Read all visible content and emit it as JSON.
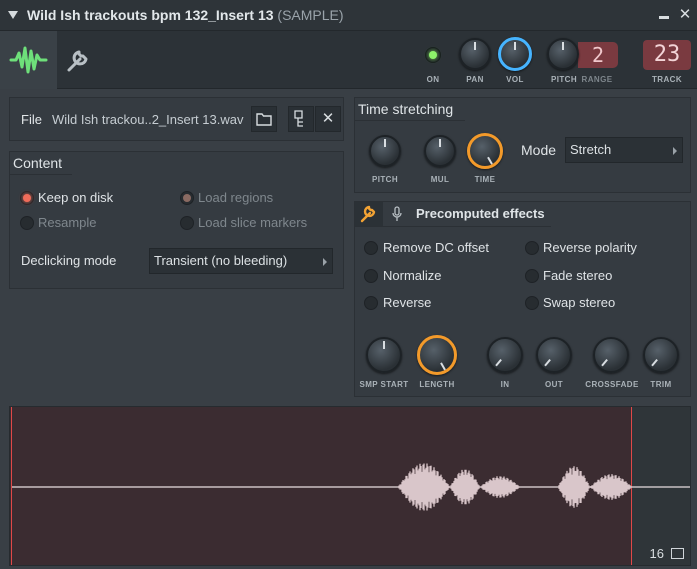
{
  "window": {
    "title": "Wild Ish trackouts bpm 132_Insert 13",
    "title_tag": "(SAMPLE)",
    "minimize_glyph": "▬",
    "close_glyph": "✕"
  },
  "toolbar": {
    "knobs": {
      "on_label": "ON",
      "pan_label": "PAN",
      "vol_label": "VOL",
      "pitch_label": "PITCH",
      "range_label": "RANGE",
      "track_label": "TRACK"
    },
    "range_value": "2",
    "track_value": "23",
    "on_led_color": "#8df36a"
  },
  "file": {
    "label": "File",
    "name": "Wild Ish trackou..2_Insert 13.wav",
    "buttons": [
      "folder-icon",
      "file-browser-icon",
      "close-icon"
    ]
  },
  "content": {
    "header": "Content",
    "options": {
      "keep_on_disk": "Keep on disk",
      "resample": "Resample",
      "load_regions": "Load regions",
      "load_slice_markers": "Load slice markers"
    },
    "declicking_label": "Declicking mode",
    "declicking_value": "Transient (no bleeding)"
  },
  "time_stretching": {
    "header": "Time stretching",
    "knob_labels": [
      "PITCH",
      "MUL",
      "TIME"
    ],
    "mode_label": "Mode",
    "mode_value": "Stretch"
  },
  "precomputed": {
    "header": "Precomputed effects",
    "effects_left": [
      "Remove DC offset",
      "Normalize",
      "Reverse"
    ],
    "effects_right": [
      "Reverse polarity",
      "Fade stereo",
      "Swap stereo"
    ],
    "knob_labels": [
      "SMP START",
      "LENGTH",
      "IN",
      "OUT",
      "CROSSFADE",
      "TRIM"
    ]
  },
  "waveform": {
    "zoom_value": "16"
  },
  "colors": {
    "accent_blue": "#46b4ff",
    "accent_orange": "#f39a2a",
    "radio_on": "#f06c5a",
    "marker": "#e04848",
    "waveform": "#d9c6ca"
  }
}
